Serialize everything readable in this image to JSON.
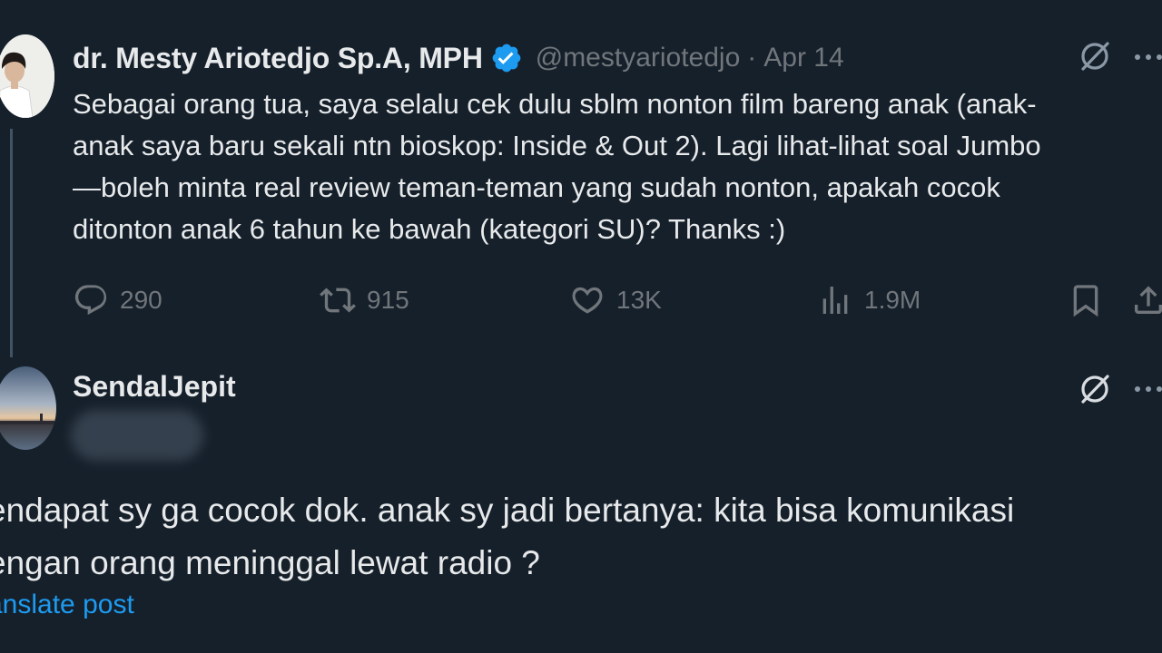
{
  "tweet": {
    "author_name": "dr. Mesty Ariotedjo Sp.A, MPH",
    "handle": "@mestyariotedjo",
    "separator": "·",
    "date": "Apr 14",
    "body_lines": [
      "Sebagai orang tua, saya selalu cek dulu sblm nonton film bareng anak (anak-",
      "anak saya baru sekali ntn bioskop: Inside & Out 2). Lagi lihat-lihat soal Jumbo",
      "—boleh minta real review teman-teman yang sudah nonton, apakah cocok",
      "ditonton anak 6 tahun ke bawah (kategori SU)? Thanks :)"
    ],
    "stats": {
      "replies": "290",
      "reposts": "915",
      "likes": "13K",
      "views": "1.9M"
    },
    "verified_color": "#1d9bf0"
  },
  "reply": {
    "author_name": "SendalJepit",
    "body_lines": [
      "endapat sy ga cocok dok. anak sy jadi bertanya: kita bisa komunikasi",
      "engan orang meninggal lewat radio ?"
    ],
    "translate_label": "anslate post"
  },
  "icons": {
    "grok": "grok-icon",
    "more": "more-icon",
    "reply": "reply-icon",
    "repost": "repost-icon",
    "like": "heart-icon",
    "views": "views-icon",
    "bookmark": "bookmark-icon",
    "share": "share-icon"
  },
  "colors": {
    "background": "#15202b",
    "text": "#e7e9ea",
    "secondary": "#71767b",
    "accent": "#1d9bf0"
  }
}
